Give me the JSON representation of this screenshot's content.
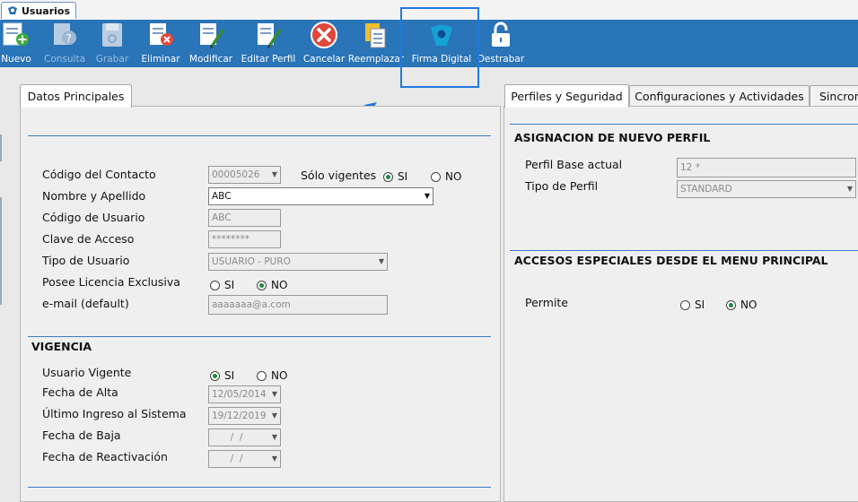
{
  "window": {
    "tab_title": "Usuarios"
  },
  "toolbar": {
    "buttons": [
      {
        "id": "nuevo",
        "label": "Nuevo",
        "enabled": true
      },
      {
        "id": "consulta",
        "label": "Consulta",
        "enabled": false
      },
      {
        "id": "grabar",
        "label": "Grabar",
        "enabled": false
      },
      {
        "id": "eliminar",
        "label": "Eliminar",
        "enabled": true
      },
      {
        "id": "modificar",
        "label": "Modificar",
        "enabled": true
      },
      {
        "id": "editar_perfil",
        "label": "Editar Perfil",
        "enabled": true
      },
      {
        "id": "cancelar",
        "label": "Cancelar",
        "enabled": true
      },
      {
        "id": "reemplazar",
        "label": "Reemplazar",
        "enabled": true
      },
      {
        "id": "firma_digital",
        "label": "Firma Digital",
        "enabled": true
      },
      {
        "id": "destrabar",
        "label": "Destrabar",
        "enabled": true
      }
    ],
    "background": "#2a74b8"
  },
  "left_panel": {
    "tab": "Datos Principales",
    "fields": {
      "codigo_contacto": {
        "label": "Código del Contacto",
        "value": "00005026"
      },
      "solo_vigentes": {
        "label": "Sólo vigentes",
        "options": [
          "SI",
          "NO"
        ],
        "selected": "SI"
      },
      "nombre_apellido": {
        "label": "Nombre y Apellido",
        "value": "ABC"
      },
      "codigo_usuario": {
        "label": "Código de Usuario",
        "value": "ABC"
      },
      "clave_acceso": {
        "label": "Clave de Acceso",
        "value": "********"
      },
      "tipo_usuario": {
        "label": "Tipo de Usuario",
        "value": "USUARIO - PURO"
      },
      "licencia_exclusiva": {
        "label": "Posee Licencia Exclusiva",
        "options": [
          "SI",
          "NO"
        ],
        "selected": "NO"
      },
      "email": {
        "label": "e-mail (default)",
        "value": "aaaaaaa@a.com"
      }
    },
    "vigencia": {
      "title": "VIGENCIA",
      "usuario_vigente": {
        "label": "Usuario Vigente",
        "options": [
          "SI",
          "NO"
        ],
        "selected": "SI"
      },
      "fecha_alta": {
        "label": "Fecha de Alta",
        "value": "12/05/2014"
      },
      "ultimo_ingreso": {
        "label": "Último Ingreso al Sistema",
        "value": "19/12/2019"
      },
      "fecha_baja": {
        "label": "Fecha de Baja",
        "value": "  /  /"
      },
      "fecha_reactivacion": {
        "label": "Fecha de Reactivación",
        "value": "  /  /"
      }
    }
  },
  "right_panel": {
    "tabs": [
      "Perfiles y Seguridad",
      "Configuraciones y Actividades",
      "Sincron"
    ],
    "asignacion": {
      "title": "ASIGNACION DE NUEVO PERFIL",
      "perfil_base": {
        "label": "Perfil Base actual",
        "value": "12 *"
      },
      "tipo_perfil": {
        "label": "Tipo de Perfil",
        "value": "STANDARD"
      }
    },
    "accesos": {
      "title": "ACCESOS ESPECIALES DESDE EL MENU PRINCIPAL",
      "permite": {
        "label": "Permite",
        "options": [
          "SI",
          "NO"
        ],
        "selected": "NO"
      }
    }
  },
  "colors": {
    "accent": "#2a74b8",
    "section_line": "#3c7cc4",
    "highlight": "#1f7ae0",
    "radio_on": "#1a8a3a"
  }
}
